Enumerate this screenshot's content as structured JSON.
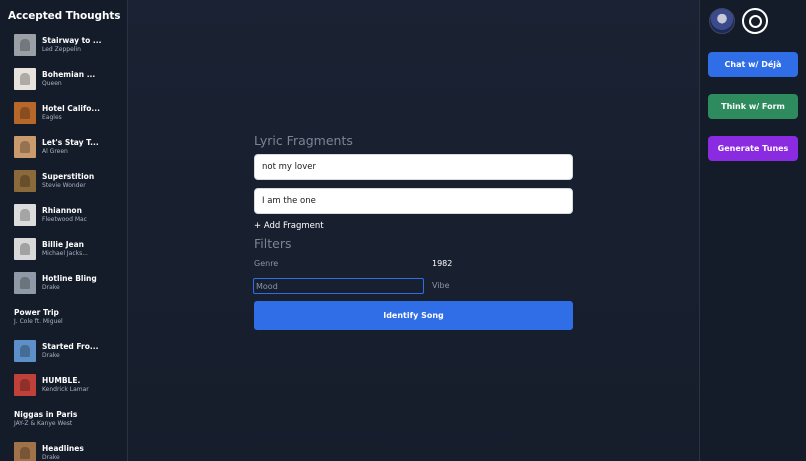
{
  "sidebar": {
    "title": "Accepted Thoughts",
    "items": [
      {
        "title": "Stairway to ...",
        "artist": "Led Zeppelin",
        "has_thumb": true,
        "thumb_color": "#9aa0a6"
      },
      {
        "title": "Bohemian ...",
        "artist": "Queen",
        "has_thumb": true,
        "thumb_color": "#e8e3dc"
      },
      {
        "title": "Hotel Califo...",
        "artist": "Eagles",
        "has_thumb": true,
        "thumb_color": "#b8672a"
      },
      {
        "title": "Let's Stay T...",
        "artist": "Al Green",
        "has_thumb": true,
        "thumb_color": "#c99a6b"
      },
      {
        "title": "Superstition",
        "artist": "Stevie Wonder",
        "has_thumb": true,
        "thumb_color": "#8a6a3a"
      },
      {
        "title": "Rhiannon",
        "artist": "Fleetwood Mac",
        "has_thumb": true,
        "thumb_color": "#dcdcdc"
      },
      {
        "title": "Billie Jean",
        "artist": "Michael Jacks...",
        "has_thumb": true,
        "thumb_color": "#d9d9d9"
      },
      {
        "title": "Hotline Bling",
        "artist": "Drake",
        "has_thumb": true,
        "thumb_color": "#8f9aa6"
      },
      {
        "title": "Power Trip",
        "artist": "J. Cole ft. Miguel",
        "has_thumb": false,
        "thumb_color": ""
      },
      {
        "title": "Started Fro...",
        "artist": "Drake",
        "has_thumb": true,
        "thumb_color": "#5d8fc9"
      },
      {
        "title": "HUMBLE.",
        "artist": "Kendrick Lamar",
        "has_thumb": true,
        "thumb_color": "#c0413a"
      },
      {
        "title": "Niggas in Paris",
        "artist": "JAY-Z & Kanye West",
        "has_thumb": false,
        "thumb_color": ""
      },
      {
        "title": "Headlines",
        "artist": "Drake",
        "has_thumb": true,
        "thumb_color": "#a0724a"
      }
    ]
  },
  "main": {
    "lyric_title": "Lyric Fragments",
    "fragments": [
      "not my lover",
      "I am the one"
    ],
    "add_fragment": "+ Add Fragment",
    "filters_title": "Filters",
    "genre_label": "Genre",
    "year_value": "1982",
    "mood_placeholder": "Mood",
    "vibe_label": "Vibe",
    "identify_label": "Identify Song"
  },
  "rightbar": {
    "chat_label": "Chat w/ Déjà",
    "think_label": "Think w/ Form",
    "generate_label": "Generate Tunes"
  },
  "colors": {
    "accent_blue": "#2f6ee6",
    "accent_green": "#2e8b5e",
    "accent_purple": "#8a2be2",
    "background": "#1a2233"
  },
  "icons": {
    "avatar": "user-avatar",
    "record": "vinyl-record-icon"
  }
}
